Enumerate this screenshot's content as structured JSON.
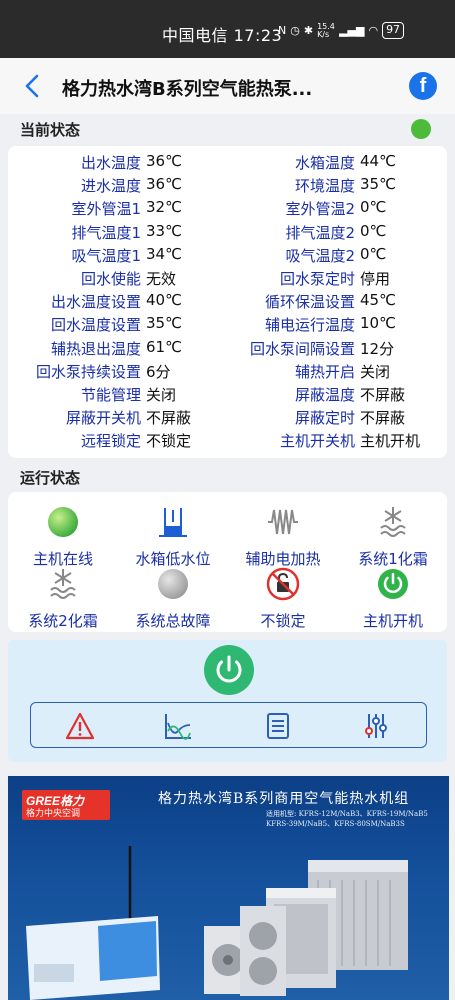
{
  "status_bar": {
    "carrier_time": "中国电信 17:23",
    "net_speed": "15.4 K/s",
    "battery": "97"
  },
  "header": {
    "title": "格力热水湾B系列空气能热泵...",
    "fb_label": "f"
  },
  "current_status": {
    "title": "当前状态",
    "rows": [
      {
        "l1": "出水温度",
        "v1": "36℃",
        "l2": "水箱温度",
        "v2": "44℃"
      },
      {
        "l1": "进水温度",
        "v1": "36℃",
        "l2": "环境温度",
        "v2": "35℃"
      },
      {
        "l1": "室外管温1",
        "v1": "32℃",
        "l2": "室外管温2",
        "v2": "0℃"
      },
      {
        "l1": "排气温度1",
        "v1": "33℃",
        "l2": "排气温度2",
        "v2": "0℃"
      },
      {
        "l1": "吸气温度1",
        "v1": "34℃",
        "l2": "吸气温度2",
        "v2": "0℃"
      },
      {
        "l1": "回水使能",
        "v1": "无效",
        "l2": "回水泵定时",
        "v2": "停用"
      },
      {
        "l1": "出水温度设置",
        "v1": "40℃",
        "l2": "循环保温设置",
        "v2": "45℃"
      },
      {
        "l1": "回水温度设置",
        "v1": "35℃",
        "l2": "辅电运行温度",
        "v2": "10℃"
      },
      {
        "l1": "辅热退出温度",
        "v1": "61℃",
        "l2": "回水泵间隔设置",
        "v2": "12分"
      },
      {
        "l1": "回水泵持续设置",
        "v1": "6分",
        "l2": "辅热开启",
        "v2": "关闭"
      },
      {
        "l1": "节能管理",
        "v1": "关闭",
        "l2": "屏蔽温度",
        "v2": "不屏蔽"
      },
      {
        "l1": "屏蔽开关机",
        "v1": "不屏蔽",
        "l2": "屏蔽定时",
        "v2": "不屏蔽"
      },
      {
        "l1": "远程锁定",
        "v1": "不锁定",
        "l2": "主机开关机",
        "v2": "主机开机"
      }
    ]
  },
  "run_status": {
    "title": "运行状态",
    "items": [
      {
        "label": "主机在线",
        "icon": "green-dot-icon"
      },
      {
        "label": "水箱低水位",
        "icon": "water-level-icon"
      },
      {
        "label": "辅助电加热",
        "icon": "electric-heater-icon"
      },
      {
        "label": "系统1化霜",
        "icon": "defrost-icon"
      },
      {
        "label": "系统2化霜",
        "icon": "defrost-icon"
      },
      {
        "label": "系统总故障",
        "icon": "gray-dot-icon"
      },
      {
        "label": "不锁定",
        "icon": "unlocked-icon"
      },
      {
        "label": "主机开机",
        "icon": "power-on-icon"
      }
    ]
  },
  "banner": {
    "logo_line1": "GREE格力",
    "logo_line2": "格力中央空调",
    "title": "格力热水湾B系列商用空气能热水机组",
    "models_line1": "适用机型: KFRS-12M/NaB3、KFRS-19M/NaB5",
    "models_line2": "KFRS-39M/NaB5、KFRS-80SM/NaB3S"
  },
  "colors": {
    "label_blue": "#1a2fa8",
    "online_green": "#4cbb3a",
    "power_green": "#2eb872",
    "panel_bg": "#dceefa",
    "alarm_red": "#e03030"
  }
}
